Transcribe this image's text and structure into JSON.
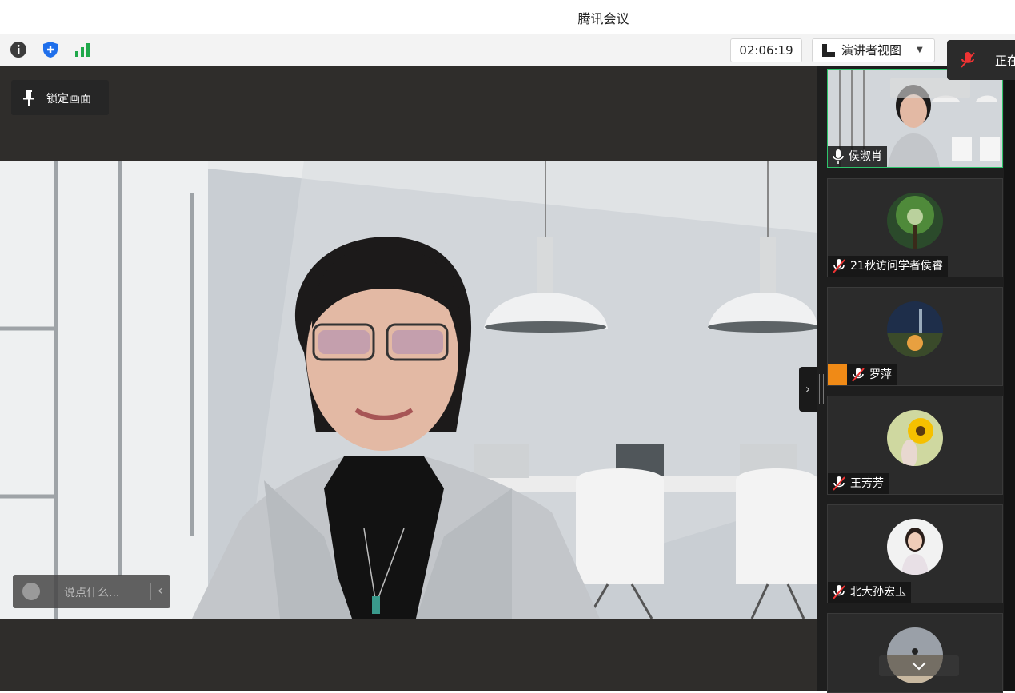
{
  "window": {
    "title": "腾讯会议"
  },
  "toolbar": {
    "icons": [
      "info-icon",
      "shield-icon",
      "signal-icon"
    ],
    "timer": "02:06:19",
    "view_button_label": "演讲者视图",
    "speaking_label": "正在"
  },
  "stage": {
    "lock_label": "锁定画面",
    "chat_placeholder": "说点什么..."
  },
  "participants": [
    {
      "name": "侯淑肖",
      "mic": "on"
    },
    {
      "name": "21秋访问学者侯睿",
      "mic": "muted"
    },
    {
      "name": "罗萍",
      "mic": "muted",
      "host_badge": true
    },
    {
      "name": "王芳芳",
      "mic": "muted"
    },
    {
      "name": "北大孙宏玉",
      "mic": "muted"
    },
    {
      "name": "",
      "mic": ""
    }
  ],
  "colors": {
    "active_border": "#2ec36a",
    "host_badge": "#f08a16",
    "muted": "#e33"
  }
}
